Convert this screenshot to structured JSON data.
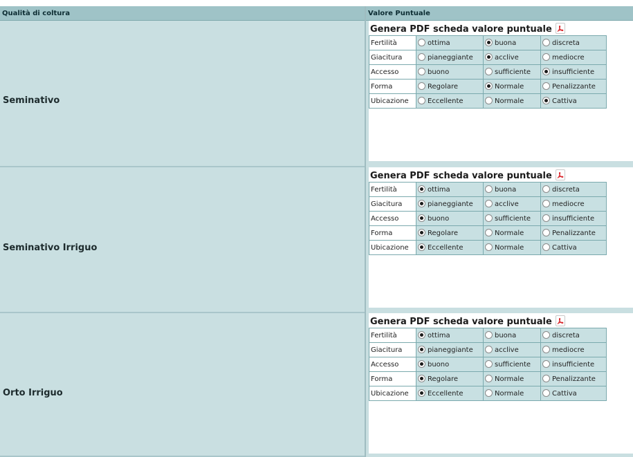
{
  "header": {
    "col_quality": "Qualità di coltura",
    "col_value": "Valore Puntuale"
  },
  "pdf_link_text": "Genera PDF scheda valore puntuale",
  "rows": [
    {
      "label": "Seminativo",
      "params": [
        {
          "name": "Fertilità",
          "options": [
            "ottima",
            "buona",
            "discreta"
          ],
          "selected": 1
        },
        {
          "name": "Giacitura",
          "options": [
            "pianeggiante",
            "acclive",
            "mediocre"
          ],
          "selected": 1
        },
        {
          "name": "Accesso",
          "options": [
            "buono",
            "sufficiente",
            "insufficiente"
          ],
          "selected": 2
        },
        {
          "name": "Forma",
          "options": [
            "Regolare",
            "Normale",
            "Penalizzante"
          ],
          "selected": 1
        },
        {
          "name": "Ubicazione",
          "options": [
            "Eccellente",
            "Normale",
            "Cattiva"
          ],
          "selected": 2
        }
      ]
    },
    {
      "label": "Seminativo Irriguo",
      "params": [
        {
          "name": "Fertilità",
          "options": [
            "ottima",
            "buona",
            "discreta"
          ],
          "selected": 0
        },
        {
          "name": "Giacitura",
          "options": [
            "pianeggiante",
            "acclive",
            "mediocre"
          ],
          "selected": 0
        },
        {
          "name": "Accesso",
          "options": [
            "buono",
            "sufficiente",
            "insufficiente"
          ],
          "selected": 0
        },
        {
          "name": "Forma",
          "options": [
            "Regolare",
            "Normale",
            "Penalizzante"
          ],
          "selected": 0
        },
        {
          "name": "Ubicazione",
          "options": [
            "Eccellente",
            "Normale",
            "Cattiva"
          ],
          "selected": 0
        }
      ]
    },
    {
      "label": "Orto Irriguo",
      "params": [
        {
          "name": "Fertilità",
          "options": [
            "ottima",
            "buona",
            "discreta"
          ],
          "selected": 0
        },
        {
          "name": "Giacitura",
          "options": [
            "pianeggiante",
            "acclive",
            "mediocre"
          ],
          "selected": 0
        },
        {
          "name": "Accesso",
          "options": [
            "buono",
            "sufficiente",
            "insufficiente"
          ],
          "selected": 0
        },
        {
          "name": "Forma",
          "options": [
            "Regolare",
            "Normale",
            "Penalizzante"
          ],
          "selected": 0
        },
        {
          "name": "Ubicazione",
          "options": [
            "Eccellente",
            "Normale",
            "Cattiva"
          ],
          "selected": 0
        }
      ]
    }
  ],
  "icons": {
    "pdf": "pdf-icon"
  },
  "colors": {
    "header_bg": "#9fc3c7",
    "cell_bg": "#c9dfe1",
    "option_bg": "#c8e0e2",
    "border": "#7aa9ad",
    "pdf_red": "#d8262b"
  }
}
